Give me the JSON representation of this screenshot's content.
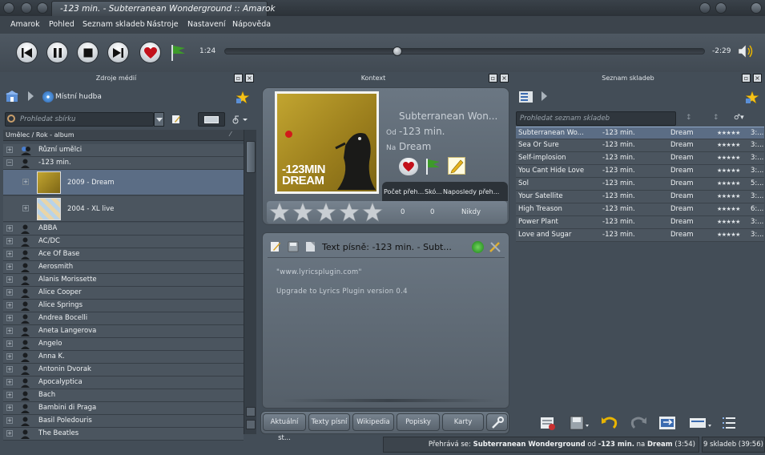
{
  "window": {
    "title": "-123 min. - Subterranean Wonderground :: Amarok"
  },
  "menu": [
    "Amarok",
    "Pohled",
    "Seznam skladeb",
    "Nástroje",
    "Nastavení",
    "Nápověda"
  ],
  "player": {
    "elapsed": "1:24",
    "remaining": "-2:29",
    "progress": 0.36
  },
  "panels": {
    "left_title": "Zdroje médií",
    "mid_title": "Kontext",
    "right_title": "Seznam skladeb"
  },
  "collection": {
    "breadcrumb": "Místní hudba",
    "search_placeholder": "Prohledat sbírku",
    "column_header": "Umělec / Rok - album",
    "items": [
      {
        "label": "Různí umělci",
        "type": "artist"
      },
      {
        "label": "-123 min.",
        "type": "artist"
      },
      {
        "label": "2009 - Dream",
        "type": "album"
      },
      {
        "label": "2004 - XL live",
        "type": "album"
      },
      {
        "label": "ABBA",
        "type": "artist"
      },
      {
        "label": "AC/DC",
        "type": "artist"
      },
      {
        "label": "Ace Of Base",
        "type": "artist"
      },
      {
        "label": "Aerosmith",
        "type": "artist"
      },
      {
        "label": "Alanis Morissette",
        "type": "artist"
      },
      {
        "label": "Alice Cooper",
        "type": "artist"
      },
      {
        "label": "Alice Springs",
        "type": "artist"
      },
      {
        "label": "Andrea Bocelli",
        "type": "artist"
      },
      {
        "label": "Aneta Langerova",
        "type": "artist"
      },
      {
        "label": "Angelo",
        "type": "artist"
      },
      {
        "label": "Anna K.",
        "type": "artist"
      },
      {
        "label": "Antonin Dvorak",
        "type": "artist"
      },
      {
        "label": "Apocalyptica",
        "type": "artist"
      },
      {
        "label": "Bach",
        "type": "artist"
      },
      {
        "label": "Bambini di Praga",
        "type": "artist"
      },
      {
        "label": "Basil Poledouris",
        "type": "artist"
      },
      {
        "label": "The Beatles",
        "type": "artist"
      }
    ]
  },
  "context": {
    "cover_text": "-123MIN DREAM",
    "title": "Subterranean Won...",
    "by_label": "Od",
    "artist": "-123 min.",
    "on_label": "Na",
    "album": "Dream",
    "stats_headers": [
      "Počet přeh...",
      "Skó...",
      "Naposledy přeh..."
    ],
    "stats_values": [
      "0",
      "0",
      "Nikdy"
    ],
    "rating": 5,
    "lyrics_title": "Text písně: -123 min. - Subt...",
    "lyrics_lines": [
      "\"www.lyricsplugin.com\"",
      "Upgrade to Lyrics Plugin version 0.4"
    ],
    "tabs": [
      "Aktuální st...",
      "Texty písní",
      "Wikipedia",
      "Popisky",
      "Karty"
    ]
  },
  "playlist": {
    "search_placeholder": "Prohledat seznam skladeb",
    "rows": [
      {
        "title": "Subterranean Wo...",
        "artist": "-123 min.",
        "album": "Dream",
        "stars": "★★★★★",
        "len": "3:..."
      },
      {
        "title": "Sea Or Sure",
        "artist": "-123 min.",
        "album": "Dream",
        "stars": "★★★★★",
        "len": "3:..."
      },
      {
        "title": "Self-implosion",
        "artist": "-123 min.",
        "album": "Dream",
        "stars": "★★★★★",
        "len": "3:..."
      },
      {
        "title": "You Cant Hide Love",
        "artist": "-123 min.",
        "album": "Dream",
        "stars": "★★★★★",
        "len": "3:..."
      },
      {
        "title": "Sol",
        "artist": "-123 min.",
        "album": "Dream",
        "stars": "★★★★★",
        "len": "5:..."
      },
      {
        "title": "Your Satellite",
        "artist": "-123 min.",
        "album": "Dream",
        "stars": "★★★★★",
        "len": "3:..."
      },
      {
        "title": "High Treason",
        "artist": "-123 min.",
        "album": "Dream",
        "stars": "★★★★★",
        "len": "6:..."
      },
      {
        "title": "Power Plant",
        "artist": "-123 min.",
        "album": "Dream",
        "stars": "★★★★★",
        "len": "3:..."
      },
      {
        "title": "Love and Sugar",
        "artist": "-123 min.",
        "album": "Dream",
        "stars": "★★★★★",
        "len": "3:..."
      }
    ]
  },
  "status": {
    "prefix": "Přehrává se: ",
    "track": "Subterranean Wonderground",
    "od": " od ",
    "artist": "-123 min.",
    "na": " na ",
    "album": "Dream",
    "duration": " (3:54)",
    "summary": "9 skladeb (39:56)"
  },
  "colors": {
    "accent_green": "#3d9a2a",
    "heart_red": "#c2101a",
    "selection": "#5b6d85"
  }
}
